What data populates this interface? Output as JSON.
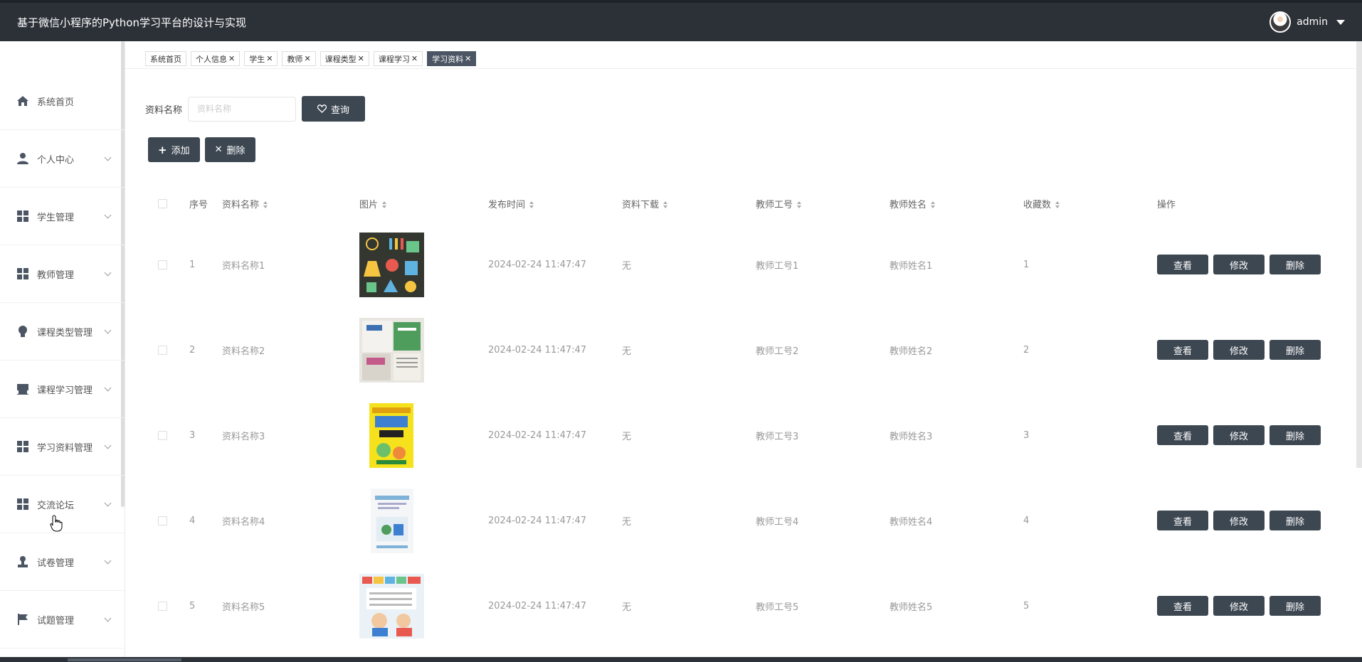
{
  "app": {
    "title": "基于微信小程序的Python学习平台的设计与实现",
    "user": "admin",
    "accent": "#3d4752",
    "topbar_color": "#2c3138"
  },
  "sidebar": {
    "items": [
      {
        "label": "系统首页",
        "icon": "home-icon"
      },
      {
        "label": "个人中心",
        "icon": "user-icon"
      },
      {
        "label": "学生管理",
        "icon": "grid-icon"
      },
      {
        "label": "教师管理",
        "icon": "grid-icon"
      },
      {
        "label": "课程类型管理",
        "icon": "bulb-icon"
      },
      {
        "label": "课程学习管理",
        "icon": "shop-icon"
      },
      {
        "label": "学习资料管理",
        "icon": "grid-icon"
      },
      {
        "label": "交流论坛",
        "icon": "grid-icon"
      },
      {
        "label": "试卷管理",
        "icon": "stamp-icon"
      },
      {
        "label": "试题管理",
        "icon": "flag-icon"
      }
    ]
  },
  "tabs": [
    {
      "label": "系统首页",
      "closable": false
    },
    {
      "label": "个人信息",
      "closable": true
    },
    {
      "label": "学生",
      "closable": true
    },
    {
      "label": "教师",
      "closable": true
    },
    {
      "label": "课程类型",
      "closable": true
    },
    {
      "label": "课程学习",
      "closable": true
    },
    {
      "label": "学习资料",
      "closable": true,
      "active": true
    }
  ],
  "search": {
    "label": "资料名称",
    "placeholder": "资料名称",
    "button": "查询"
  },
  "toolbar": {
    "add": "添加",
    "delete": "删除"
  },
  "table": {
    "headers": {
      "no": "序号",
      "name": "资料名称",
      "image": "图片",
      "time": "发布时间",
      "download": "资料下载",
      "teacher_id": "教师工号",
      "teacher_name": "教师姓名",
      "favorites": "收藏数",
      "operations": "操作"
    },
    "row_buttons": {
      "view": "查看",
      "edit": "修改",
      "delete": "删除"
    },
    "rows": [
      {
        "no": "1",
        "name": "资料名称1",
        "time": "2024-02-24 11:47:47",
        "download": "无",
        "teacher_id": "教师工号1",
        "teacher_name": "教师姓名1",
        "favorites": "1"
      },
      {
        "no": "2",
        "name": "资料名称2",
        "time": "2024-02-24 11:47:47",
        "download": "无",
        "teacher_id": "教师工号2",
        "teacher_name": "教师姓名2",
        "favorites": "2"
      },
      {
        "no": "3",
        "name": "资料名称3",
        "time": "2024-02-24 11:47:47",
        "download": "无",
        "teacher_id": "教师工号3",
        "teacher_name": "教师姓名3",
        "favorites": "3"
      },
      {
        "no": "4",
        "name": "资料名称4",
        "time": "2024-02-24 11:47:47",
        "download": "无",
        "teacher_id": "教师工号4",
        "teacher_name": "教师姓名4",
        "favorites": "4"
      },
      {
        "no": "5",
        "name": "资料名称5",
        "time": "2024-02-24 11:47:47",
        "download": "无",
        "teacher_id": "教师工号5",
        "teacher_name": "教师姓名5",
        "favorites": "5"
      }
    ]
  }
}
